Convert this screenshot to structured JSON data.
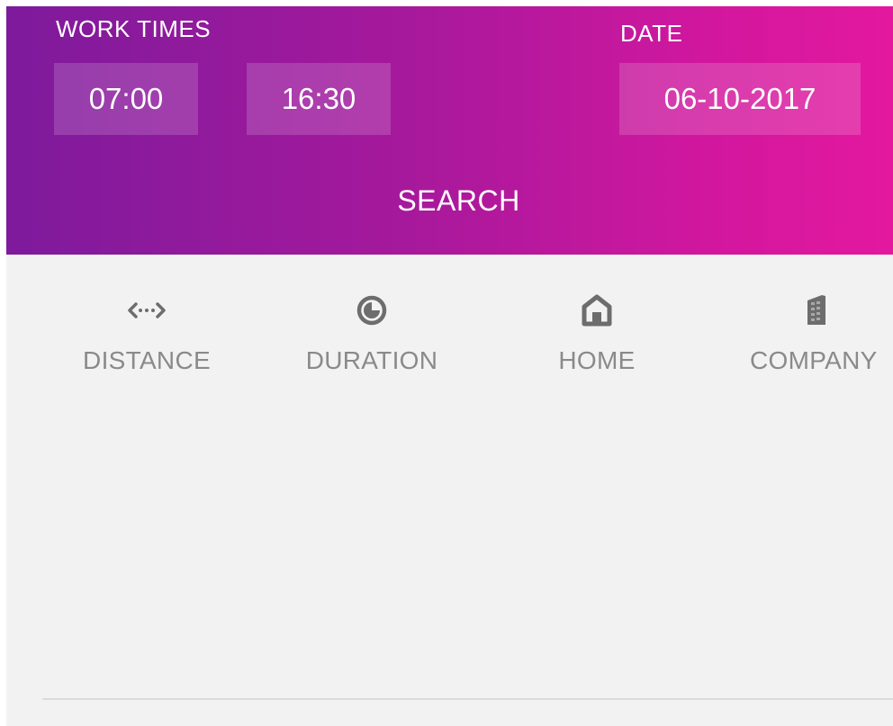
{
  "header": {
    "work_times_label": "WORK TIMES",
    "start_time": "07:00",
    "end_time": "16:30",
    "date_label": "DATE",
    "date_value": "06-10-2017",
    "search_label": "SEARCH",
    "gradient_start": "#7e1a9c",
    "gradient_end": "#e3189f"
  },
  "sort_options": [
    {
      "label": "DISTANCE",
      "icon": "arrows-horizontal-icon"
    },
    {
      "label": "DURATION",
      "icon": "clock-icon"
    },
    {
      "label": "HOME",
      "icon": "home-icon"
    },
    {
      "label": "COMPANY",
      "icon": "building-icon"
    }
  ],
  "colors": {
    "content_bg": "#f3f2f2",
    "icon_gray": "#6d6d6d",
    "label_gray": "#8a8a8a"
  }
}
